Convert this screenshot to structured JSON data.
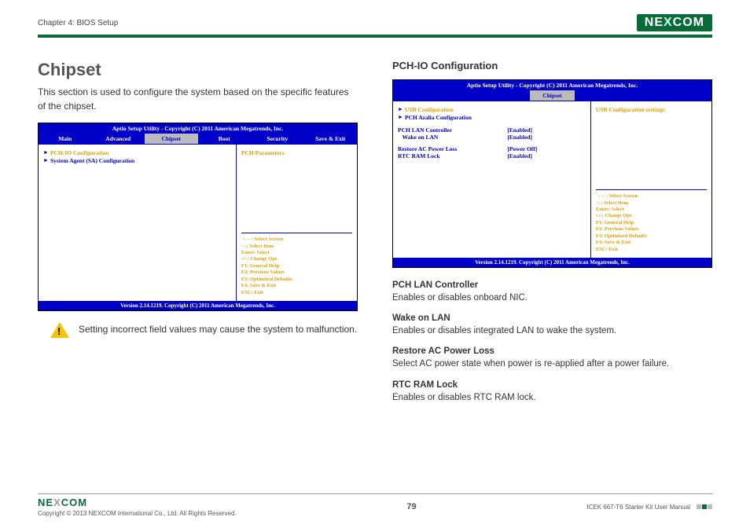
{
  "header": {
    "chapter": "Chapter 4: BIOS Setup",
    "brand": "NEXCOM"
  },
  "left": {
    "title": "Chipset",
    "intro": "This section is used to configure the system based on the specific features of the chipset.",
    "bios": {
      "topbar": "Aptio Setup Utility - Copyright (C) 2011 American Megatrends, Inc.",
      "tabs": [
        "Main",
        "Advanced",
        "Chipset",
        "Boot",
        "Security",
        "Save & Exit"
      ],
      "active_tab": "Chipset",
      "items": [
        "PCH-IO Configuration",
        "System Agent (SA) Configuration"
      ],
      "right_info": "PCH Parameters",
      "help": [
        "→←: Select Screen",
        "↑↓: Select Item",
        "Enter: Select",
        "+/-: Change Opt.",
        "F1: General Help",
        "F2: Previous Values",
        "F3: Optimized Defaults",
        "F4: Save & Exit",
        "ESC: Exit"
      ],
      "footer": "Version 2.14.1219. Copyright (C) 2011 American Megatrends, Inc."
    },
    "warning": "Setting incorrect field values may cause the system to malfunction."
  },
  "right": {
    "subtitle": "PCH-IO Configuration",
    "bios": {
      "topbar": "Aptio Setup Utility - Copyright (C) 2011 American Megatrends, Inc.",
      "tab": "Chipset",
      "submenus": [
        "USB Configuration",
        "PCH Azalia Configuration"
      ],
      "settings": [
        {
          "label": "PCH LAN Controller",
          "value": "[Enabled]"
        },
        {
          "label": "   Wake on LAN",
          "value": "[Enabled]"
        }
      ],
      "settings2": [
        {
          "label": "Restore AC Power Loss",
          "value": "[Power Off]"
        },
        {
          "label": "RTC RAM Lock",
          "value": "[Enabled]"
        }
      ],
      "right_info": "USB Configuration settings",
      "help": [
        "→←: Select Screen",
        "↑↓: Select Item",
        "Enter: Select",
        "+/-: Change Opt.",
        "F1: General Help",
        "F2: Previous Values",
        "F3: Optimized Defaults",
        "F4: Save & Exit",
        "ESC: Exit"
      ],
      "footer": "Version 2.14.1219. Copyright (C) 2011 American Megatrends, Inc."
    },
    "descriptions": [
      {
        "term": "PCH LAN Controller",
        "text": "Enables or disables onboard NIC."
      },
      {
        "term": "Wake on LAN",
        "text": "Enables or disables integrated LAN to wake the system."
      },
      {
        "term": "Restore AC Power Loss",
        "text": "Select AC power state when power is re-applied after a power failure."
      },
      {
        "term": "RTC RAM Lock",
        "text": "Enables or disables RTC RAM lock."
      }
    ]
  },
  "footer": {
    "copyright": "Copyright © 2013 NEXCOM International Co., Ltd. All Rights Reserved.",
    "page": "79",
    "manual": "ICEK 667-T6 Starter Kit User Manual"
  }
}
